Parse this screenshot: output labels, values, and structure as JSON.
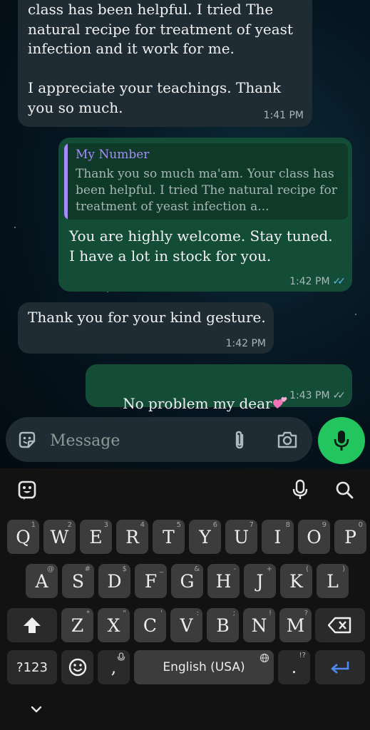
{
  "messages": [
    {
      "direction": "incoming",
      "text": "class has been helpful. I tried The natural recipe for treatment of yeast infection and it work for me.\n\nI appreciate your teachings. Thank you so much.",
      "time": "1:41 PM"
    },
    {
      "direction": "outgoing",
      "reply_to": {
        "sender": "My Number",
        "text": "Thank you so much ma'am. Your class has been helpful. I tried The natural recipe for treatment of yeast infection a..."
      },
      "text": "You are highly welcome. Stay tuned.\nI have a lot in stock for you.",
      "time": "1:42 PM",
      "status_ticks": "✓✓"
    },
    {
      "direction": "incoming",
      "text": "Thank you for your kind gesture.",
      "time": "1:42 PM"
    },
    {
      "direction": "outgoing",
      "text": "No problem my dear",
      "emoji": "two-hearts",
      "time": "1:43 PM",
      "status_ticks": "✓✓"
    }
  ],
  "composer": {
    "placeholder": "Message",
    "icons": [
      "sticker-icon",
      "attach-icon",
      "camera-icon",
      "mic-icon"
    ],
    "mic_color": "#22c55e"
  },
  "keyboard": {
    "toolbar_icons": [
      "emoji-sticker-icon",
      "voice-input-icon",
      "search-icon"
    ],
    "row1": [
      {
        "k": "Q",
        "h": "1"
      },
      {
        "k": "W",
        "h": "2"
      },
      {
        "k": "E",
        "h": "3"
      },
      {
        "k": "R",
        "h": "4"
      },
      {
        "k": "T",
        "h": "5"
      },
      {
        "k": "Y",
        "h": "6"
      },
      {
        "k": "U",
        "h": "7"
      },
      {
        "k": "I",
        "h": "8"
      },
      {
        "k": "O",
        "h": "9"
      },
      {
        "k": "P",
        "h": "0"
      }
    ],
    "row2": [
      {
        "k": "A",
        "h": "@"
      },
      {
        "k": "S",
        "h": "#"
      },
      {
        "k": "D",
        "h": "$"
      },
      {
        "k": "F",
        "h": "_"
      },
      {
        "k": "G",
        "h": "&"
      },
      {
        "k": "H",
        "h": "-"
      },
      {
        "k": "J",
        "h": "+"
      },
      {
        "k": "K",
        "h": "("
      },
      {
        "k": "L",
        "h": ")"
      }
    ],
    "row3": [
      {
        "k": "Z",
        "h": "*"
      },
      {
        "k": "X",
        "h": "\""
      },
      {
        "k": "C",
        "h": "'"
      },
      {
        "k": "V",
        "h": ":"
      },
      {
        "k": "B",
        "h": ";"
      },
      {
        "k": "N",
        "h": "!"
      },
      {
        "k": "M",
        "h": "?"
      }
    ],
    "symbols_label": "?123",
    "comma_label": ",",
    "space_label": "English (USA)",
    "period_label": ".",
    "period_hint": "!?",
    "accent_color": "#4c8bf5"
  },
  "nav": {
    "icon": "chevron-down-icon"
  },
  "colors": {
    "incoming_bubble": "#1f2c33",
    "outgoing_bubble": "#144d37",
    "read_ticks": "#53bdeb",
    "quote_accent": "#a78bfa"
  }
}
